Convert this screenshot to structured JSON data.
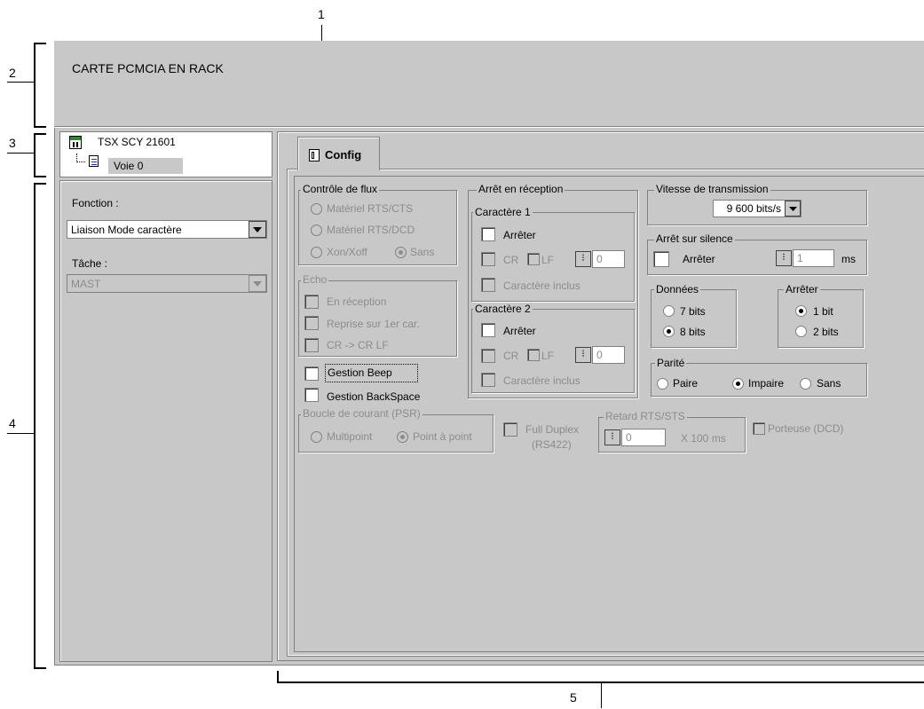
{
  "annotations": [
    "1",
    "2",
    "3",
    "4",
    "5"
  ],
  "header": {
    "title": "CARTE PCMCIA EN RACK"
  },
  "module": {
    "name": "TSX SCY 21601",
    "channel": "Voie 0",
    "module_icon": "module-icon",
    "channel_icon": "channel-icon"
  },
  "side": {
    "function_label": "Fonction :",
    "function_value": "Liaison Mode caractère",
    "task_label": "Tâche :",
    "task_value": "MAST"
  },
  "tabs": [
    {
      "label": "Config",
      "icon": "config-tab-icon"
    }
  ],
  "config": {
    "flow": {
      "title": "Contrôle de flux",
      "opt1": "Matériel RTS/CTS",
      "opt2": "Matériel RTS/DCD",
      "opt3": "Xon/Xoff",
      "opt4": "Sans"
    },
    "echo": {
      "title": "Echo",
      "opt1": "En réception",
      "opt2": "Reprise sur 1er car.",
      "opt3": "CR -> CR LF"
    },
    "beep_label": "Gestion Beep",
    "backspace_label": "Gestion BackSpace",
    "reception": {
      "title": "Arrêt en réception",
      "char1": {
        "title": "Caractère 1",
        "stop": "Arrêter",
        "cr": "CR",
        "lf": "LF",
        "value": "0",
        "included": "Caractère inclus"
      },
      "char2": {
        "title": "Caractère 2",
        "stop": "Arrêter",
        "cr": "CR",
        "lf": "LF",
        "value": "0",
        "included": "Caractère inclus"
      }
    },
    "speed": {
      "title": "Vitesse de transmission",
      "value": "9 600 bits/s"
    },
    "silence": {
      "title": "Arrêt sur silence",
      "stop": "Arrêter",
      "value": "1",
      "unit": "ms"
    },
    "data": {
      "title": "Données",
      "opt1": "7 bits",
      "opt2": "8 bits"
    },
    "stop": {
      "title": "Arrêter",
      "opt1": "1 bit",
      "opt2": "2 bits"
    },
    "parity": {
      "title": "Parité",
      "opt1": "Paire",
      "opt2": "Impaire",
      "opt3": "Sans"
    },
    "loop": {
      "title": "Boucle de courant (PSR)",
      "opt1": "Multipoint",
      "opt2": "Point à point"
    },
    "full_duplex": {
      "line1": "Full Duplex",
      "line2": "(RS422)"
    },
    "rts": {
      "title": "Retard RTS/STS",
      "value": "0",
      "unit": "X 100 ms"
    },
    "carrier": "Porteuse (DCD)"
  }
}
